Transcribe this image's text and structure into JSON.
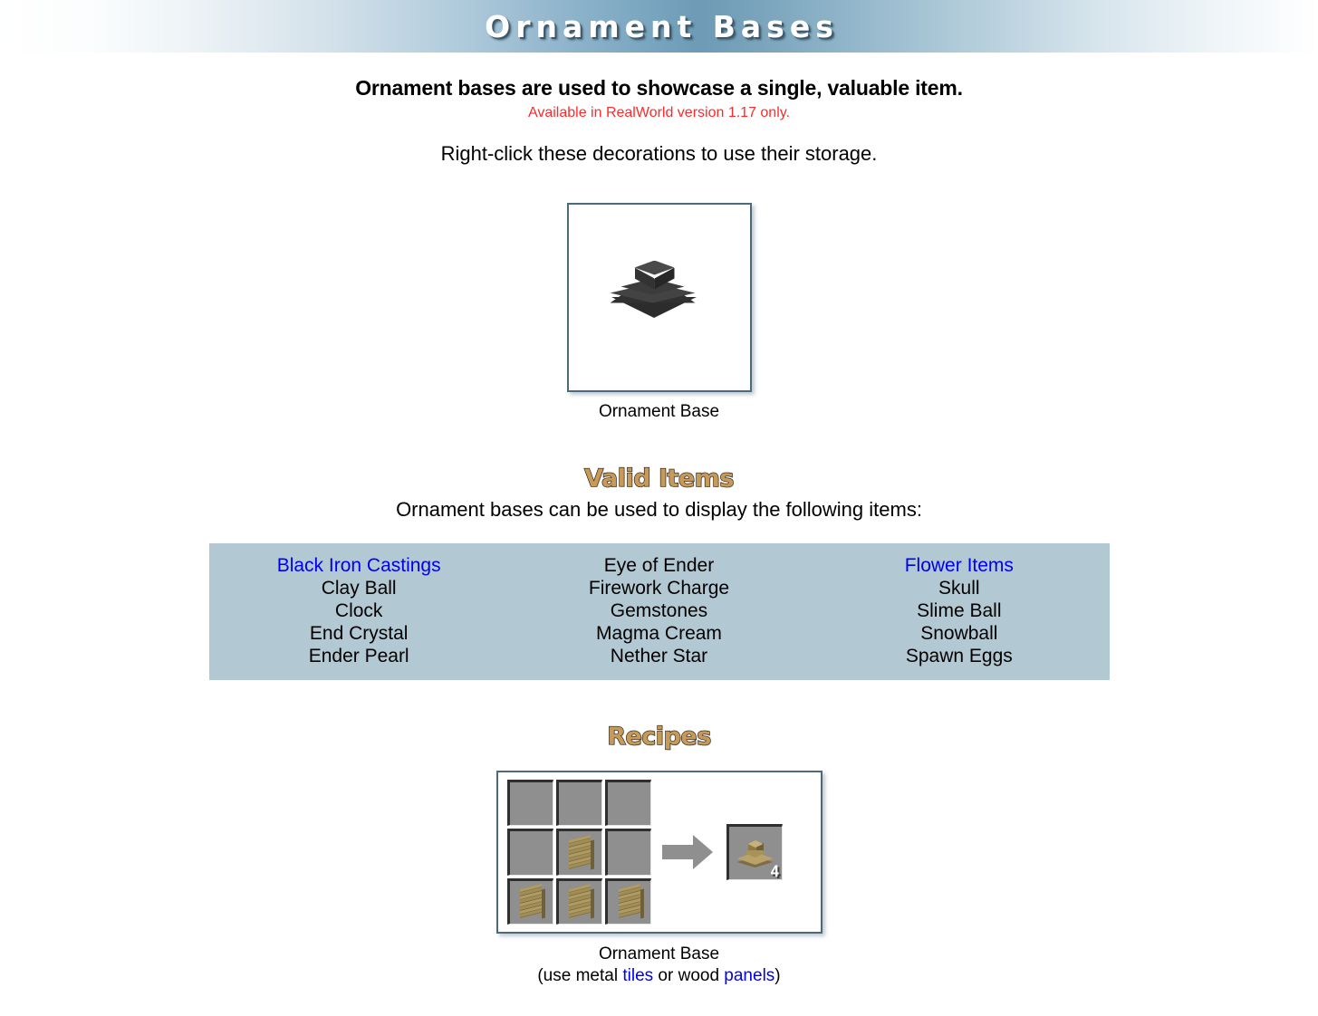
{
  "banner": {
    "title": "Ornament Bases",
    "gradient_center_color": "#6d9ab5",
    "title_color": "#ffffff"
  },
  "intro": {
    "lead": "Ornament bases are used to showcase a single, valuable item.",
    "version_note": "Available in RealWorld version 1.17 only.",
    "version_note_color": "#fc2b2b",
    "usage_note": "Right-click these decorations to use their storage."
  },
  "showcase": {
    "caption": "Ornament Base",
    "sprite_name": "ornament-base-black",
    "frame_border_color": "#4b6b7d"
  },
  "valid_items": {
    "heading": "Valid Items",
    "heading_color": "#c99a56",
    "subtext": "Ornament bases can be used to display the following items:",
    "panel_background": "#b2c8d3",
    "link_color": "#0000f0",
    "columns": [
      [
        {
          "label": "Black Iron Castings",
          "is_link": true
        },
        {
          "label": "Clay Ball",
          "is_link": false
        },
        {
          "label": "Clock",
          "is_link": false
        },
        {
          "label": "End Crystal",
          "is_link": false
        },
        {
          "label": "Ender Pearl",
          "is_link": false
        }
      ],
      [
        {
          "label": "Eye of Ender",
          "is_link": false
        },
        {
          "label": "Firework Charge",
          "is_link": false
        },
        {
          "label": "Gemstones",
          "is_link": false
        },
        {
          "label": "Magma Cream",
          "is_link": false
        },
        {
          "label": "Nether Star",
          "is_link": false
        }
      ],
      [
        {
          "label": "Flower Items",
          "is_link": true
        },
        {
          "label": "Skull",
          "is_link": false
        },
        {
          "label": "Slime Ball",
          "is_link": false
        },
        {
          "label": "Snowball",
          "is_link": false
        },
        {
          "label": "Spawn Eggs",
          "is_link": false
        }
      ]
    ]
  },
  "recipes": {
    "heading": "Recipes",
    "heading_color": "#c99a56",
    "grid": [
      [
        null,
        null,
        null
      ],
      [
        null,
        "wood-panel",
        null
      ],
      [
        "wood-panel",
        "wood-panel",
        "wood-panel"
      ]
    ],
    "arrow_icon": "right-arrow-icon",
    "result": {
      "sprite_name": "ornament-base-wood",
      "count": "4"
    },
    "caption_title": "Ornament Base",
    "caption_prefix": "(use metal ",
    "caption_link_1": "tiles",
    "caption_middle": " or wood ",
    "caption_link_2": "panels",
    "caption_suffix": ")",
    "link_color": "#0000f0"
  }
}
